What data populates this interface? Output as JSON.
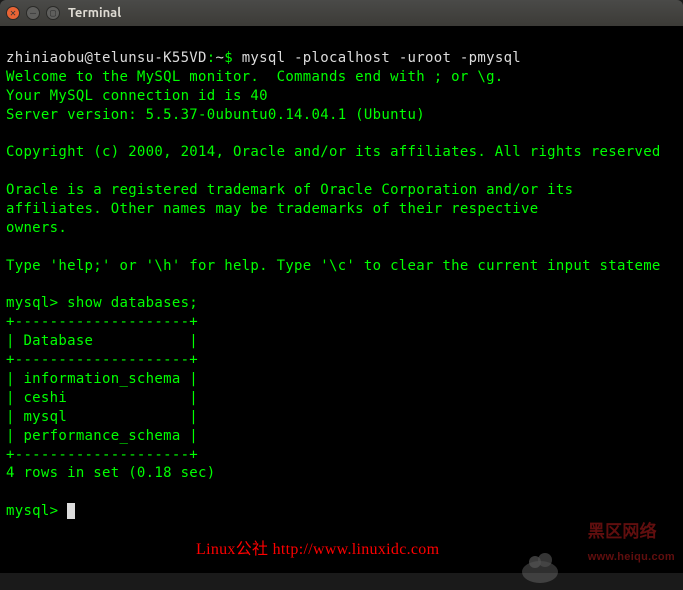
{
  "window": {
    "title": "Terminal"
  },
  "prompt": {
    "user_host": "zhiniaobu@telunsu-K55VD",
    "cwd": "~",
    "separator": "$",
    "command": "mysql -plocalhost -uroot -pmysql"
  },
  "mysql_output": {
    "welcome": "Welcome to the MySQL monitor.  Commands end with ; or \\g.",
    "connection": "Your MySQL connection id is 40",
    "version": "Server version: 5.5.37-0ubuntu0.14.04.1 (Ubuntu)",
    "copyright": "Copyright (c) 2000, 2014, Oracle and/or its affiliates. All rights reserved",
    "trademark1": "Oracle is a registered trademark of Oracle Corporation and/or its",
    "trademark2": "affiliates. Other names may be trademarks of their respective",
    "trademark3": "owners.",
    "help": "Type 'help;' or '\\h' for help. Type '\\c' to clear the current input stateme"
  },
  "query": {
    "prompt": "mysql>",
    "command": "show databases;"
  },
  "result_table": {
    "border_top": "+--------------------+",
    "header_row": "| Database           |",
    "border_mid": "+--------------------+",
    "rows": [
      "| information_schema |",
      "| ceshi              |",
      "| mysql              |",
      "| performance_schema |"
    ],
    "border_bot": "+--------------------+",
    "summary": "4 rows in set (0.18 sec)"
  },
  "watermarks": {
    "linuxidc": "Linux公社 http://www.linuxidc.com",
    "heiqu": "黑区网络",
    "heiqu_url": "www.heiqu.com"
  }
}
